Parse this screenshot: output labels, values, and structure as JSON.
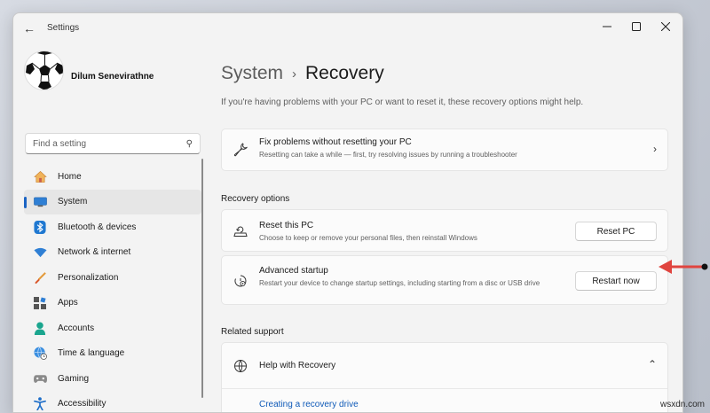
{
  "window": {
    "title": "Settings"
  },
  "user": {
    "name": "Dilum Senevirathne"
  },
  "search": {
    "placeholder": "Find a setting"
  },
  "nav": [
    {
      "label": "Home",
      "icon": "home-icon",
      "active": false
    },
    {
      "label": "System",
      "icon": "monitor-icon",
      "active": true
    },
    {
      "label": "Bluetooth & devices",
      "icon": "bluetooth-icon",
      "active": false
    },
    {
      "label": "Network & internet",
      "icon": "wifi-icon",
      "active": false
    },
    {
      "label": "Personalization",
      "icon": "brush-icon",
      "active": false
    },
    {
      "label": "Apps",
      "icon": "apps-icon",
      "active": false
    },
    {
      "label": "Accounts",
      "icon": "person-icon",
      "active": false
    },
    {
      "label": "Time & language",
      "icon": "globe-clock-icon",
      "active": false
    },
    {
      "label": "Gaming",
      "icon": "gamepad-icon",
      "active": false
    },
    {
      "label": "Accessibility",
      "icon": "accessibility-icon",
      "active": false
    }
  ],
  "breadcrumb": {
    "parent": "System",
    "separator": "›",
    "current": "Recovery"
  },
  "intro": "If you're having problems with your PC or want to reset it, these recovery options might help.",
  "fix_card": {
    "title": "Fix problems without resetting your PC",
    "subtitle": "Resetting can take a while — first, try resolving issues by running a troubleshooter",
    "icon": "wrench-icon"
  },
  "recovery_options": {
    "label": "Recovery options",
    "reset": {
      "title": "Reset this PC",
      "subtitle": "Choose to keep or remove your personal files, then reinstall Windows",
      "button": "Reset PC",
      "icon": "reset-pc-icon"
    },
    "advanced": {
      "title": "Advanced startup",
      "subtitle": "Restart your device to change startup settings, including starting from a disc or USB drive",
      "button": "Restart now",
      "icon": "advanced-startup-icon"
    }
  },
  "related_support": {
    "label": "Related support",
    "help_title": "Help with Recovery",
    "link": "Creating a recovery drive",
    "icon": "globe-icon"
  },
  "watermark": "wsxdn.com",
  "colors": {
    "accent": "#1b64c4",
    "arrow": "#e0443f",
    "link": "#0f5ab8"
  }
}
